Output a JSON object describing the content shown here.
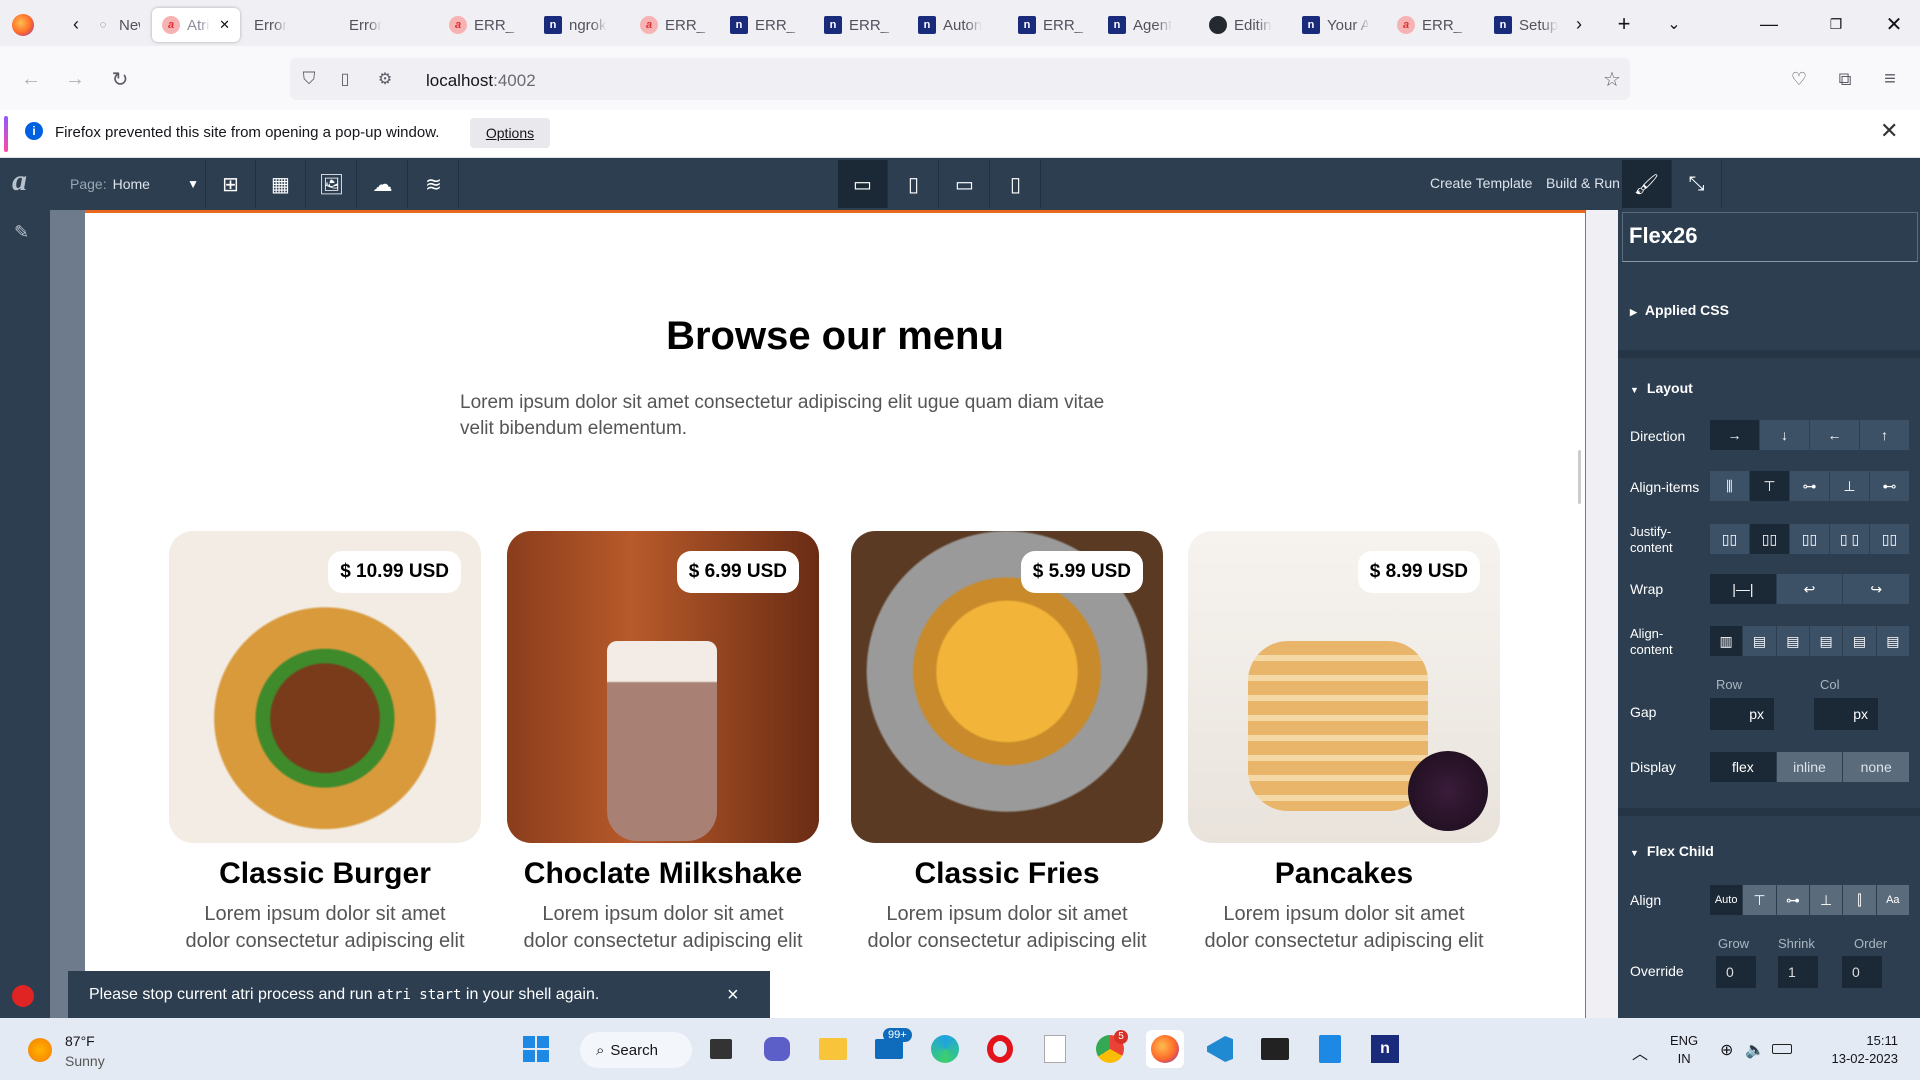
{
  "browser": {
    "tabs": [
      {
        "label": "New T",
        "icon": "globe-icon"
      },
      {
        "label": "Atri",
        "icon": "atri-icon",
        "active": true
      },
      {
        "label": "Error",
        "icon": "none"
      },
      {
        "label": "Error",
        "icon": "none"
      },
      {
        "label": "ERR_N",
        "icon": "atri-icon"
      },
      {
        "label": "ngrok",
        "icon": "n-icon"
      },
      {
        "label": "ERR_N",
        "icon": "atri-icon"
      },
      {
        "label": "ERR_N",
        "icon": "n-icon"
      },
      {
        "label": "ERR_N",
        "icon": "n-icon"
      },
      {
        "label": "Auton",
        "icon": "n-icon"
      },
      {
        "label": "ERR_N",
        "icon": "n-icon"
      },
      {
        "label": "Agent",
        "icon": "n-icon"
      },
      {
        "label": "Editin",
        "icon": "github-icon"
      },
      {
        "label": "Your A",
        "icon": "n-icon"
      },
      {
        "label": "ERR_N",
        "icon": "atri-icon"
      },
      {
        "label": "Setup",
        "icon": "n-icon"
      }
    ],
    "url_host": "localhost",
    "url_port": ":4002",
    "notification": "Firefox prevented this site from opening a pop-up window.",
    "notification_button": "Options"
  },
  "editor": {
    "logo": "a",
    "page_label": "Page:",
    "page_value": "Home",
    "create_template": "Create Template",
    "build_run": "Build & Run"
  },
  "canvas": {
    "heading": "Browse our menu",
    "subheading_line1": "Lorem ipsum dolor sit amet consectetur adipiscing elit ugue quam diam vitae",
    "subheading_line2": "velit bibendum elementum.",
    "cards": [
      {
        "title": "Classic Burger",
        "price": "$ 10.99 USD",
        "desc1": "Lorem ipsum dolor sit amet",
        "desc2": "dolor consectetur adipiscing elit"
      },
      {
        "title": "Choclate Milkshake",
        "price": "$ 6.99 USD",
        "desc1": "Lorem ipsum dolor sit amet",
        "desc2": "dolor consectetur adipiscing elit"
      },
      {
        "title": "Classic Fries",
        "price": "$ 5.99 USD",
        "desc1": "Lorem ipsum dolor sit amet",
        "desc2": "dolor consectetur adipiscing elit"
      },
      {
        "title": "Pancakes",
        "price": "$ 8.99 USD",
        "desc1": "Lorem ipsum dolor sit amet",
        "desc2": "dolor consectetur adipiscing elit"
      }
    ]
  },
  "toast": {
    "text_before": "Please stop current atri process and run ",
    "code": "atri start",
    "text_after": " in your shell again.",
    "close": "×"
  },
  "panel": {
    "component_name": "Flex26",
    "applied_css": "Applied CSS",
    "layout": "Layout",
    "direction_label": "Direction",
    "align_items_label": "Align-items",
    "justify_label_1": "Justify-",
    "justify_label_2": "content",
    "wrap_label": "Wrap",
    "align_content_label_1": "Align-",
    "align_content_label_2": "content",
    "gap_label": "Gap",
    "row_label": "Row",
    "col_label": "Col",
    "gap_row_unit": "px",
    "gap_col_unit": "px",
    "display_label": "Display",
    "display_options": [
      "flex",
      "inline",
      "none"
    ],
    "flex_child": "Flex Child",
    "align_label": "Align",
    "align_auto": "Auto",
    "override_label": "Override",
    "grow_label": "Grow",
    "shrink_label": "Shrink",
    "order_label": "Order",
    "grow_value": "0",
    "shrink_value": "1",
    "order_value": "0"
  },
  "taskbar": {
    "weather_temp": "87°F",
    "weather_desc": "Sunny",
    "search": "Search",
    "mail_badge": "99+",
    "chrome_badge": "5",
    "lang1": "ENG",
    "lang2": "IN",
    "time": "15:11",
    "date": "13-02-2023"
  },
  "colors": {
    "editor_bg": "#2c3e50",
    "accent_orange": "#e7681e",
    "canvas_gutter": "#6e7b8c"
  }
}
